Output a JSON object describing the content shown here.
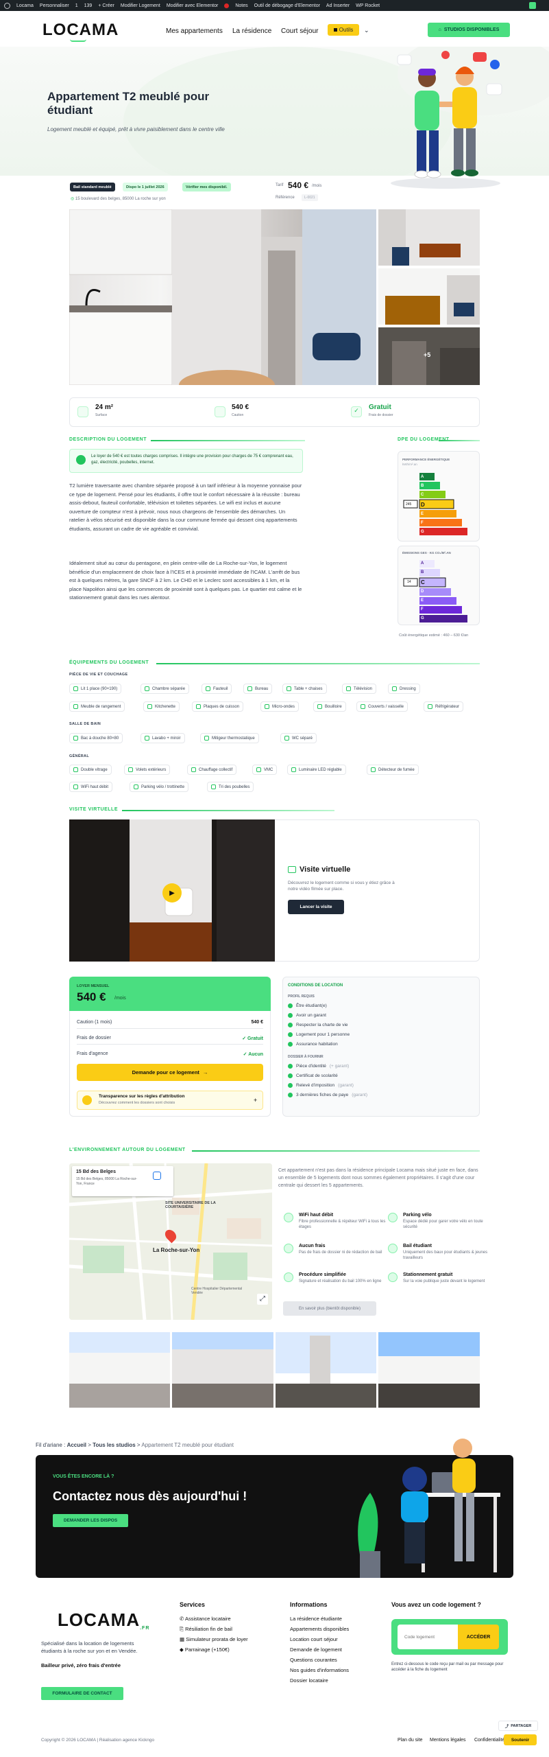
{
  "adminbar": {
    "items": [
      "Locama",
      "Personnaliser",
      "1",
      "139",
      "+ Créer",
      "Modifier Logement",
      "Modifier avec Elementor",
      "Notes",
      "Outil de débogage d'Elementor",
      "Ad Inserter",
      "WP Rocket"
    ]
  },
  "header": {
    "logo": "LOCAMA",
    "nav": [
      "Mes appartements",
      "La résidence",
      "Court séjour"
    ],
    "outils": "Outils",
    "studios": "STUDIOS DISPONIBLES"
  },
  "hero": {
    "title": "Appartement T2 meublé pour étudiant",
    "subtitle": "Logement meublé et équipé, prêt à vivre paisiblement dans le centre ville"
  },
  "badges": [
    "Bail standard meublé",
    "Dispo le 1 juillet 2026",
    "Vérifier mes disponibil."
  ],
  "address": "15 boulevard des belges, 85000 La roche sur yon",
  "price": {
    "label": "Tarif",
    "value": "540 €",
    "unit": "/mois",
    "ref_label": "Référence",
    "ref_value": "L-0021"
  },
  "gallery": {
    "more": "+5"
  },
  "stats": [
    {
      "value": "24 m²",
      "label": "Surface"
    },
    {
      "value": "540 €",
      "label": "Caution"
    },
    {
      "value": "Gratuit",
      "label": "Frais de dossier"
    }
  ],
  "description": {
    "title": "DESCRIPTION DU LOGEMENT",
    "notice": "Le loyer de 540 € est toutes charges comprises. Il intègre une provision pour charges de 75 € comprenant eau, gaz, électricité, poubelles, internet.",
    "p1": "T2 lumière traversante avec chambre séparée proposé à un tarif inférieur à la moyenne yonnaise pour ce type de logement. Pensé pour les étudiants, il offre tout le confort nécessaire à la réussite : bureau assis-debout, fauteuil confortable, télévision et toilettes séparées. Le wifi est inclus et aucune ouverture de compteur n'est à prévoir, nous nous chargeons de l'ensemble des démarches. Un ratelier à vélos sécurisé est disponible dans la cour commune fermée qui dessert cinq appartements étudiants, assurant un cadre de vie agréable et convivial.",
    "p2": "Idéalement situé au cœur du pentagone, en plein centre-ville de La Roche-sur-Yon, le logement bénéficie d'un emplacement de choix face à l'ICES et à proximité immédiate de l'ICAM. L'arrêt de bus est à quelques mètres, la gare SNCF à 2 km. Le CHD et le Leclerc sont accessibles à 1 km, et la place Napoléon ainsi que les commerces de proximité sont à quelques pas. Le quartier est calme et le stationnement gratuit dans les rues alentour."
  },
  "dpe": {
    "title": "DPE DU LOGEMENT",
    "perf_label": "PERFORMANCE ÉNERGÉTIQUE",
    "perf_sub": "kWh/m².an",
    "energy_letters": [
      "A",
      "B",
      "C",
      "D",
      "E",
      "F",
      "G"
    ],
    "energy_value": "245",
    "energy_class": "D",
    "ges_label": "ÉMISSIONS GES · KG CO₂/M².AN",
    "ges_letters": [
      "A",
      "B",
      "C",
      "D",
      "E",
      "F",
      "G"
    ],
    "ges_value": "14",
    "ges_class": "C",
    "note": "Coût énergétique estimé : 460 – 630 €/an"
  },
  "equip": {
    "title": "ÉQUIPEMENTS DU LOGEMENT",
    "g1": "PIÈCE DE VIE ET COUCHAGE",
    "g1_items": [
      "Lit 1 place (90×190)",
      "Chambre séparée",
      "Fauteuil",
      "Bureau",
      "Table + chaises",
      "Télévision",
      "Dressing",
      "Meuble de rangement",
      "Kitchenette",
      "Plaques de cuisson",
      "Micro-ondes",
      "Bouilloire",
      "Couverts / vaisselle",
      "Réfrigérateur"
    ],
    "g2": "SALLE DE BAIN",
    "g2_items": [
      "Bac à douche 80×80",
      "Lavabo + miroir",
      "Mitigeur thermostatique",
      "WC séparé"
    ],
    "g3": "GÉNÉRAL",
    "g3_items": [
      "Double vitrage",
      "Volets extérieurs",
      "Chauffage collectif",
      "VMC",
      "Luminaire LED réglable",
      "Détecteur de fumée",
      "WiFi haut débit",
      "Parking vélo / trottinette",
      "Tri des poubelles"
    ]
  },
  "visit": {
    "title": "VISITE VIRTUELLE",
    "heading": "Visite virtuelle",
    "text": "Découvrez le logement comme si vous y étiez grâce à notre vidéo filmée sur place.",
    "button": "Lancer la visite"
  },
  "rent": {
    "label": "LOYER MENSUEL",
    "value": "540 €",
    "unit": "/mois",
    "rows": [
      {
        "k": "Caution (1 mois)",
        "v": "540 €"
      },
      {
        "k": "Frais de dossier",
        "v": "✓ Gratuit"
      },
      {
        "k": "Frais d'agence",
        "v": "✓ Aucun"
      }
    ],
    "button": "Demande pour ce logement",
    "transp_title": "Transparence sur les règles d'attribution",
    "transp_text": "Découvrez comment les dossiers sont choisis"
  },
  "conditions": {
    "title": "CONDITIONS DE LOCATION",
    "g1": "PROFIL REQUIS",
    "g1_items": [
      "Être étudiant(e)",
      "Avoir un garant",
      "Respecter la charte de vie",
      "Logement pour 1 personne",
      "Assurance habitation"
    ],
    "g2": "DOSSIER À FOURNIR",
    "g2_items": [
      "Pièce d'identité",
      "Certificat de scolarité",
      "Relevé d'imposition",
      "3 dernières fiches de paye"
    ],
    "g2_extra": [
      "(+ garant)",
      "",
      "(garant)",
      "(garant)"
    ]
  },
  "env": {
    "title": "L'ENVIRONNEMENT AUTOUR DU LOGEMENT",
    "map_place": "15 Bd des Belges",
    "map_addr": "15 Bd des Belges, 85000 La Roche-sur-Yon, France",
    "map_city": "La Roche-sur-Yon",
    "map_labels": [
      "SITE UNIVERSITAIRE DE LA COURTAISIÈRE",
      "Centre Hospitalier Départemental Vendée"
    ],
    "intro": "Cet appartement n'est pas dans la résidence principale Locama mais situé juste en face, dans un ensemble de 5 logements dont nous sommes également propriétaires. Il s'agit d'une cour centrale qui dessert les 5 appartements.",
    "features": [
      {
        "t": "WiFi haut débit",
        "d": "Fibre professionnelle & répéteur WiFi à tous les étages"
      },
      {
        "t": "Parking vélo",
        "d": "Espace dédié pour garer votre vélo en toute sécurité"
      },
      {
        "t": "Aucun frais",
        "d": "Pas de frais de dossier ni de rédaction de bail"
      },
      {
        "t": "Bail étudiant",
        "d": "Uniquement des baux pour étudiants & jeunes travailleurs"
      },
      {
        "t": "Procédure simplifiée",
        "d": "Signature et réalisation du bail 100% en ligne"
      },
      {
        "t": "Stationnement gratuit",
        "d": "Sur la voie publique juste devant le logement"
      }
    ],
    "more": "En savoir plus (bientôt disponible)"
  },
  "breadcrumb": {
    "label": "Fil d'ariane :",
    "items": [
      "Accueil",
      "Tous les studios",
      "Appartement T2 meublé pour étudiant"
    ]
  },
  "cta": {
    "kicker": "VOUS ÊTES ENCORE LÀ ?",
    "title": "Contactez nous dès aujourd'hui !",
    "button": "DEMANDER LES DISPOS"
  },
  "footer": {
    "logo": "LOCAMA",
    "logo_sub": ".FR",
    "about": "Spécialisé dans la location de logements étudiants à la roche sur yon et en Vendée.",
    "about2": "Bailleur privé, zéro frais d'entrée",
    "contact": "FORMULAIRE DE CONTACT",
    "services_title": "Services",
    "services": [
      "Assistance locataire",
      "Résiliation fin de bail",
      "Simulateur prorata de loyer",
      "Parrainage (+150€)"
    ],
    "info_title": "Informations",
    "info": [
      "La résidence étudiante",
      "Appartements disponibles",
      "Location court séjour",
      "Demande de logement",
      "Questions courantes",
      "Nos guides d'informations",
      "Dossier locataire"
    ],
    "code_title": "Vous avez un code logement ?",
    "code_placeholder": "Code logement",
    "code_button": "ACCÉDER",
    "code_help": "Entrez ci-dessous le code reçu par mail ou par message pour accéder à la fiche du logement",
    "copyright": "Copyright © 2026 LOCAMA | Réalisation agence Kickngo",
    "links": [
      "Plan du site",
      "Mentions légales",
      "Confidentialité"
    ],
    "share": "PARTAGER",
    "support": "Soutenir"
  }
}
